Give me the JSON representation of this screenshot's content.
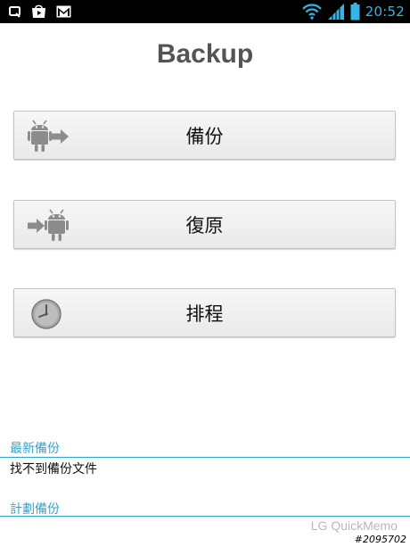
{
  "status_bar": {
    "time": "20:52",
    "notification_icons": [
      "quickmemo-icon",
      "play-store-icon",
      "gmail-icon"
    ],
    "system_icons": [
      "wifi-icon",
      "signal-icon",
      "battery-icon"
    ],
    "accent_color": "#33b5e5"
  },
  "page": {
    "title": "Backup"
  },
  "buttons": {
    "backup": {
      "label": "備份",
      "icon": "android-export-icon"
    },
    "restore": {
      "label": "復原",
      "icon": "android-import-icon"
    },
    "schedule": {
      "label": "排程",
      "icon": "clock-icon"
    }
  },
  "sections": {
    "latest_backup": {
      "header": "最新備份",
      "value": "找不到備份文件"
    },
    "scheduled_backup": {
      "header": "計劃備份"
    },
    "header_color": "#33a5cc"
  },
  "watermarks": {
    "app": "LG QuickMemo",
    "id": "#2095702"
  }
}
